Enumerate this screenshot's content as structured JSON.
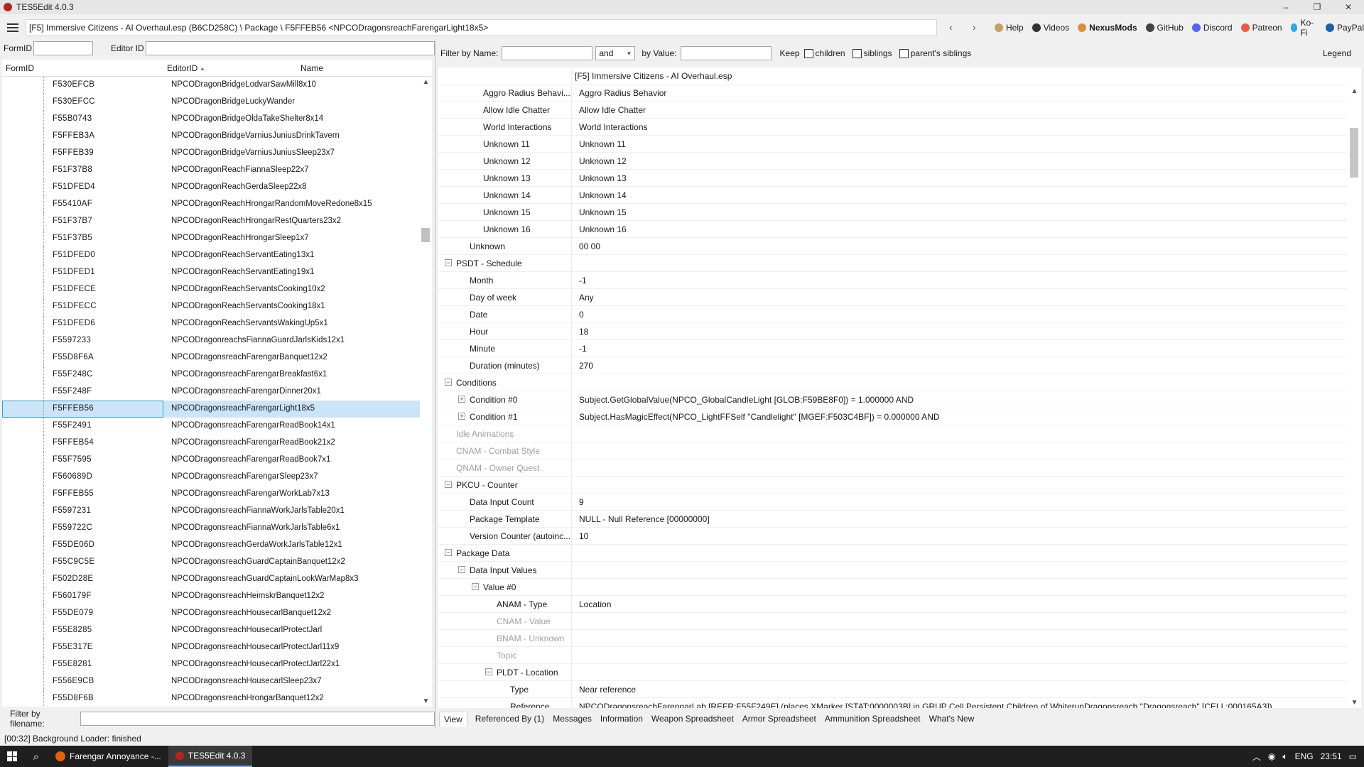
{
  "window": {
    "title": "TES5Edit 4.0.3",
    "minimize": "–",
    "maximize": "❐",
    "close": "✕"
  },
  "pathbar": {
    "path": "[F5] Immersive Citizens - AI Overhaul.esp (B6CD258C) \\ Package \\ F5FFEB56 <NPCODragonsreachFarengarLight18x5>",
    "back": "‹",
    "forward": "›"
  },
  "links": [
    {
      "label": "Help",
      "icon": "book-icon",
      "color": "#c8a060"
    },
    {
      "label": "Videos",
      "icon": "video-icon",
      "color": "#333333"
    },
    {
      "label": "NexusMods",
      "icon": "nexus-icon",
      "color": "#d98f40"
    },
    {
      "label": "GitHub",
      "icon": "github-icon",
      "color": "#444444"
    },
    {
      "label": "Discord",
      "icon": "discord-icon",
      "color": "#5865f2"
    },
    {
      "label": "Patreon",
      "icon": "patreon-icon",
      "color": "#e85b46"
    },
    {
      "label": "Ko-Fi",
      "icon": "kofi-icon",
      "color": "#29abe0"
    },
    {
      "label": "PayPal",
      "icon": "paypal-icon",
      "color": "#1f5faa"
    }
  ],
  "left_filter": {
    "formid_label": "FormID",
    "formid_value": "",
    "editorid_label": "Editor ID",
    "editorid_value": ""
  },
  "left_columns": {
    "formid": "FormID",
    "editorid": "EditorID",
    "sort_arrow": "▲",
    "name": "Name"
  },
  "left_rows": [
    {
      "fid": "F530EFCB",
      "eid": "NPCODragonBridgeLodvarSawMill8x10"
    },
    {
      "fid": "F530EFCC",
      "eid": "NPCODragonBridgeLuckyWander"
    },
    {
      "fid": "F55B0743",
      "eid": "NPCODragonBridgeOldaTakeShelter8x14"
    },
    {
      "fid": "F5FFEB3A",
      "eid": "NPCODragonBridgeVarniusJuniusDrinkTavern"
    },
    {
      "fid": "F5FFEB39",
      "eid": "NPCODragonBridgeVarniusJuniusSleep23x7"
    },
    {
      "fid": "F51F37B8",
      "eid": "NPCODragonReachFiannaSleep22x7"
    },
    {
      "fid": "F51DFED4",
      "eid": "NPCODragonReachGerdaSleep22x8"
    },
    {
      "fid": "F55410AF",
      "eid": "NPCODragonReachHrongarRandomMoveRedone8x15"
    },
    {
      "fid": "F51F37B7",
      "eid": "NPCODragonReachHrongarRestQuarters23x2"
    },
    {
      "fid": "F51F37B5",
      "eid": "NPCODragonReachHrongarSleep1x7"
    },
    {
      "fid": "F51DFED0",
      "eid": "NPCODragonReachServantEating13x1"
    },
    {
      "fid": "F51DFED1",
      "eid": "NPCODragonReachServantEating19x1"
    },
    {
      "fid": "F51DFECE",
      "eid": "NPCODragonReachServantsCooking10x2"
    },
    {
      "fid": "F51DFECC",
      "eid": "NPCODragonReachServantsCooking18x1"
    },
    {
      "fid": "F51DFED6",
      "eid": "NPCODragonReachServantsWakingUp5x1"
    },
    {
      "fid": "F5597233",
      "eid": "NPCODragonreachsFiannaGuardJarlsKids12x1"
    },
    {
      "fid": "F55D8F6A",
      "eid": "NPCODragonsreachFarengarBanquet12x2"
    },
    {
      "fid": "F55F248C",
      "eid": "NPCODragonsreachFarengarBreakfast6x1"
    },
    {
      "fid": "F55F248F",
      "eid": "NPCODragonsreachFarengarDinner20x1"
    },
    {
      "fid": "F5FFEB56",
      "eid": "NPCODragonsreachFarengarLight18x5",
      "selected": true
    },
    {
      "fid": "F55F2491",
      "eid": "NPCODragonsreachFarengarReadBook14x1"
    },
    {
      "fid": "F5FFEB54",
      "eid": "NPCODragonsreachFarengarReadBook21x2"
    },
    {
      "fid": "F55F7595",
      "eid": "NPCODragonsreachFarengarReadBook7x1"
    },
    {
      "fid": "F560689D",
      "eid": "NPCODragonsreachFarengarSleep23x7"
    },
    {
      "fid": "F5FFEB55",
      "eid": "NPCODragonsreachFarengarWorkLab7x13"
    },
    {
      "fid": "F5597231",
      "eid": "NPCODragonsreachFiannaWorkJarlsTable20x1"
    },
    {
      "fid": "F559722C",
      "eid": "NPCODragonsreachFiannaWorkJarlsTable6x1"
    },
    {
      "fid": "F55DE06D",
      "eid": "NPCODragonsreachGerdaWorkJarlsTable12x1"
    },
    {
      "fid": "F55C9C5E",
      "eid": "NPCODragonsreachGuardCaptainBanquet12x2"
    },
    {
      "fid": "F502D28E",
      "eid": "NPCODragonsreachGuardCaptainLookWarMap8x3"
    },
    {
      "fid": "F560179F",
      "eid": "NPCODragonsreachHeimskrBanquet12x2"
    },
    {
      "fid": "F55DE079",
      "eid": "NPCODragonsreachHousecarlBanquet12x2"
    },
    {
      "fid": "F55E8285",
      "eid": "NPCODragonsreachHousecarlProtectJarl"
    },
    {
      "fid": "F55E317E",
      "eid": "NPCODragonsreachHousecarlProtectJarl11x9"
    },
    {
      "fid": "F55E8281",
      "eid": "NPCODragonsreachHousecarlProtectJarl22x1"
    },
    {
      "fid": "F556E9CB",
      "eid": "NPCODragonsreachHousecarlSleep23x7"
    },
    {
      "fid": "F55D8F6B",
      "eid": "NPCODragonsreachHrongarBanquet12x2"
    }
  ],
  "file_filter": {
    "label": "Filter by filename:",
    "value": ""
  },
  "right_filter": {
    "by_name_label": "Filter by Name:",
    "name_value": "",
    "operator": "and",
    "by_value_label": "by Value:",
    "value_value": "",
    "keep_label": "Keep",
    "children": "children",
    "siblings": "siblings",
    "parents_siblings": "parent's siblings",
    "legend": "Legend"
  },
  "header_value": "[F5] Immersive Citizens - AI Overhaul.esp",
  "record_rows": [
    {
      "name": "Aggro Radius Behavi...",
      "value": "Aggro Radius Behavior",
      "indent": 3
    },
    {
      "name": "Allow Idle Chatter",
      "value": "Allow Idle Chatter",
      "indent": 3
    },
    {
      "name": "World Interactions",
      "value": "World Interactions",
      "indent": 3
    },
    {
      "name": "Unknown 11",
      "value": "Unknown 11",
      "indent": 3
    },
    {
      "name": "Unknown 12",
      "value": "Unknown 12",
      "indent": 3
    },
    {
      "name": "Unknown 13",
      "value": "Unknown 13",
      "indent": 3
    },
    {
      "name": "Unknown 14",
      "value": "Unknown 14",
      "indent": 3
    },
    {
      "name": "Unknown 15",
      "value": "Unknown 15",
      "indent": 3
    },
    {
      "name": "Unknown 16",
      "value": "Unknown 16",
      "indent": 3
    },
    {
      "name": "Unknown",
      "value": "00 00",
      "indent": 2
    },
    {
      "name": "PSDT - Schedule",
      "value": "",
      "indent": 1,
      "expander": "−"
    },
    {
      "name": "Month",
      "value": "-1",
      "indent": 2
    },
    {
      "name": "Day of week",
      "value": "Any",
      "indent": 2
    },
    {
      "name": "Date",
      "value": "0",
      "indent": 2
    },
    {
      "name": "Hour",
      "value": "18",
      "indent": 2
    },
    {
      "name": "Minute",
      "value": "-1",
      "indent": 2
    },
    {
      "name": "Duration (minutes)",
      "value": "270",
      "indent": 2
    },
    {
      "name": "Conditions",
      "value": "",
      "indent": 1,
      "expander": "−"
    },
    {
      "name": "Condition #0",
      "value": "Subject.GetGlobalValue(NPCO_GlobalCandleLight [GLOB:F59BE8F0]) = 1.000000 AND",
      "indent": 2,
      "expander": "+"
    },
    {
      "name": "Condition #1",
      "value": "Subject.HasMagicEffect(NPCO_LightFFSelf \"Candlelight\" [MGEF:F503C4BF]) = 0.000000 AND",
      "indent": 2,
      "expander": "+"
    },
    {
      "name": "Idle Animations",
      "value": "",
      "indent": 1,
      "disabled": true
    },
    {
      "name": "CNAM - Combat Style",
      "value": "",
      "indent": 1,
      "disabled": true
    },
    {
      "name": "QNAM - Owner Quest",
      "value": "",
      "indent": 1,
      "disabled": true
    },
    {
      "name": "PKCU - Counter",
      "value": "",
      "indent": 1,
      "expander": "−"
    },
    {
      "name": "Data Input Count",
      "value": "9",
      "indent": 2
    },
    {
      "name": "Package Template",
      "value": "NULL - Null Reference [00000000]",
      "indent": 2
    },
    {
      "name": "Version Counter (autoinc...",
      "value": "10",
      "indent": 2
    },
    {
      "name": "Package Data",
      "value": "",
      "indent": 1,
      "expander": "−"
    },
    {
      "name": "Data Input Values",
      "value": "",
      "indent": 2,
      "expander": "−"
    },
    {
      "name": "Value #0",
      "value": "",
      "indent": 3,
      "expander": "−"
    },
    {
      "name": "ANAM - Type",
      "value": "Location",
      "indent": 4
    },
    {
      "name": "CNAM - Value",
      "value": "",
      "indent": 4,
      "disabled": true
    },
    {
      "name": "BNAM - Unknown",
      "value": "",
      "indent": 4,
      "disabled": true
    },
    {
      "name": "Topic",
      "value": "",
      "indent": 4,
      "disabled": true
    },
    {
      "name": "PLDT - Location",
      "value": "",
      "indent": 4,
      "expander": "−"
    },
    {
      "name": "Type",
      "value": "Near reference",
      "indent": 5
    },
    {
      "name": "Reference",
      "value": "NPCODragonsreachFarengarLab [REFR:F55F249E] (places XMarker [STAT:0000003B] in GRUP Cell Persistent Children of WhiterunDragonsreach \"Dragonsreach\" [CELL:000165A3])",
      "indent": 5
    }
  ],
  "tabs": [
    "View",
    "Referenced By (1)",
    "Messages",
    "Information",
    "Weapon Spreadsheet",
    "Armor Spreadsheet",
    "Ammunition Spreadsheet",
    "What's New"
  ],
  "status": "[00:32] Background Loader: finished",
  "taskbar": {
    "app1": "Farengar Annoyance -...",
    "app2": "TES5Edit 4.0.3",
    "lang": "ENG",
    "time": "23:51"
  }
}
